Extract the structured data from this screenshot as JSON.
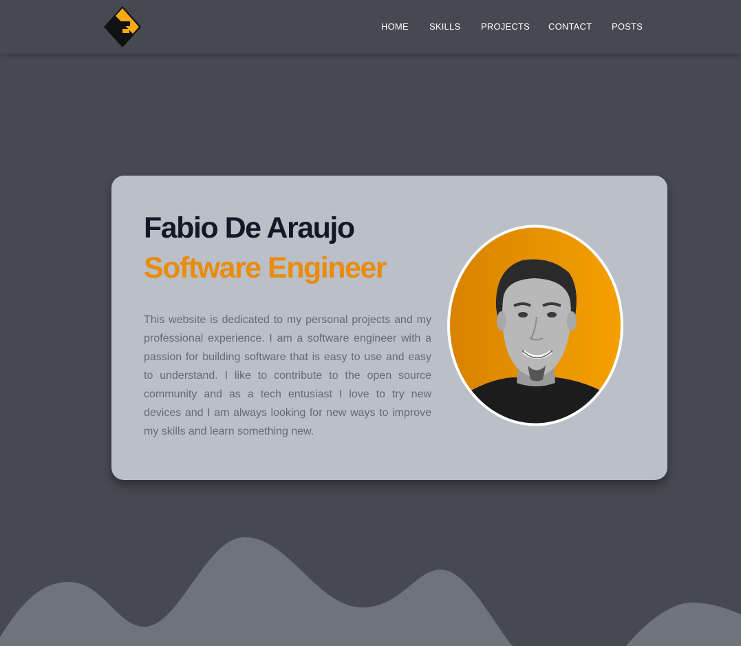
{
  "nav": {
    "logo": "logo",
    "items": [
      {
        "label": "HOME"
      },
      {
        "label": "SKILLS"
      },
      {
        "label": "PROJECTS"
      },
      {
        "label": "CONTACT"
      },
      {
        "label": "POSTS"
      }
    ]
  },
  "hero": {
    "name": "Fabio De Araujo",
    "role": "Software Engineer",
    "bio": "This website is dedicated to my personal projects and my professional experience. I am a software engineer with a passion for building software that is easy to use and easy to understand. I like to contribute to the open source community and as a tech entusiast I love to try new devices and I am always looking for new ways to improve my skills and learn something new.",
    "photo": "profile-photo"
  },
  "colors": {
    "background": "#464952",
    "card": "#bbbfc8",
    "accent": "#e88c0a",
    "name_text": "#111827",
    "bio_text": "#646a76",
    "waves": "#6f737b",
    "logo_yellow": "#f5a914"
  }
}
